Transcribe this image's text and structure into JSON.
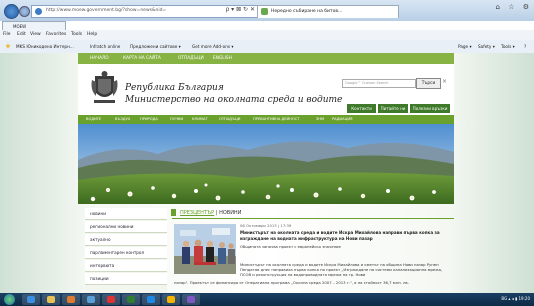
{
  "browser": {
    "address_url": "http://www.moew.government.bg/?show=news&nid=",
    "active_tab": "Нередно събиране на битов...",
    "small_tab": "MOEW",
    "address_controls": "ρ ▾ ⊠ ↻ ✕",
    "window_controls": "⌂ ☆ ⚙",
    "menu": [
      "File",
      "Edit",
      "View",
      "Favorites",
      "Tools",
      "Help"
    ],
    "favorites": [
      "MKS Юникодена Интерн...",
      "Infratch online",
      "Предложени сайтове ▾",
      "Get more Add-ons ▾"
    ],
    "tools": [
      "Page ▾",
      "Safety ▾",
      "Tools ▾",
      "?"
    ]
  },
  "site": {
    "top_links": [
      "НАЧАЛО",
      "КАРТА НА САЙТА",
      "ОТПАДЪЦИ",
      "ENGLISH"
    ],
    "title_line1": "Република България",
    "title_line2": "Министерство на околната среда и водите",
    "search_placeholder": "Google™ Custom Search",
    "search_button": "Търси",
    "header_close": "×",
    "header_buttons": [
      "Контакти",
      "Питайте ни",
      "Полезни връзки"
    ],
    "main_nav": [
      "ВОДИТЕ",
      "ВЪЗДУХ",
      "ПРИРОДА",
      "ПОЧВИ",
      "КЛИМАТ",
      "ОТПАДЪЦИ",
      "ПРЕВАНТИВНА ДЕЙНОСТ",
      "ЗНМ",
      "РАДИАЦИЯ"
    ],
    "sidebar": [
      "новини",
      "регионални новини",
      "актуално",
      "парламентарен контрол",
      "интервюта",
      "позиции"
    ],
    "breadcrumb": {
      "parent": "ПРЕЗЦЕНТЪР",
      "separator": " | ",
      "current": "НОВИНИ"
    },
    "news": {
      "date": "06 Октомври 2013 | 17:39",
      "headline": "Министърът на околната среда и водите Искра Михайлова направи първа копка за изграждане на водната инфраструктура на Нови пазар",
      "subtitle": "Общината започва проект с европейско значение",
      "body": "Министърът на околната среда и водите Искра Михайлова и кметът на община Нови пазар Рупен Пендатов днес направиха първа копка по проект „Изграждане на системи канализационна мрежа, ПСОВ и реконструкция на водопроводната мрежа на гр. Нови",
      "body2": "пазар\". Проектът се финансира от Оперативна програма „Околна среда 2007 – 2013 г.\", а на стойност 36,7 млн. лв."
    }
  },
  "taskbar": {
    "tray_text": "BG ▴ ◂ ▮ 19:20"
  },
  "colors": {
    "site_green": "#6aa02c",
    "header_button_green": "#3f7a2a",
    "taskbar": "#0e2a47"
  }
}
